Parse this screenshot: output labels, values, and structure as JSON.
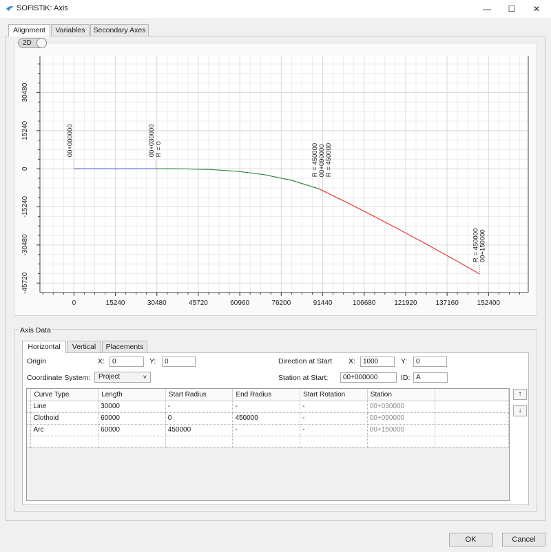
{
  "window": {
    "title": "SOFiSTiK: Axis",
    "minimize": "—",
    "maximize": "☐",
    "close": "✕"
  },
  "tabs": [
    "Alignment",
    "Variables",
    "Secondary Axes"
  ],
  "view_toggle": "2D",
  "chart_data": {
    "type": "line",
    "x_ticks": [
      "0",
      "15240",
      "30480",
      "45720",
      "60960",
      "76200",
      "91440",
      "106680",
      "121920",
      "137160",
      "152400"
    ],
    "y_ticks": [
      "30480",
      "15240",
      "0",
      "-15240",
      "-30480",
      "-45720"
    ],
    "xlim": [
      -12500,
      167000
    ],
    "ylim": [
      -49500,
      45200
    ],
    "grid": true,
    "series": [
      {
        "color": "#4a5de8",
        "x": [
          0,
          30000
        ],
        "y": [
          0,
          0
        ]
      },
      {
        "color": "#2f8a3a",
        "x": [
          30000,
          40000,
          50000,
          60000,
          70000,
          80000,
          89990
        ],
        "y": [
          0,
          -37,
          -296,
          -1000,
          -2370,
          -4630,
          -7995
        ]
      },
      {
        "color": "#e83a3a",
        "x": [
          89990,
          100000,
          110000,
          120000,
          130000,
          140000,
          149150
        ],
        "y": [
          -7995,
          -13333,
          -18867,
          -24566,
          -30427,
          -36449,
          -42100
        ]
      }
    ],
    "annotations": [
      {
        "x": 0,
        "y": 0,
        "lines": [
          "00+000000"
        ]
      },
      {
        "x": 30000,
        "y": 0,
        "lines": [
          "00+030000",
          "R = 0"
        ]
      },
      {
        "x": 89990,
        "y": -7995,
        "lines": [
          "R = 450000",
          "00+090000",
          "R = 450000"
        ]
      },
      {
        "x": 149150,
        "y": -42100,
        "lines": [
          "R = 450000",
          "00+150000"
        ]
      }
    ]
  },
  "axis_data": {
    "label": "Axis Data",
    "tabs": [
      "Horizontal",
      "Vertical",
      "Placements"
    ],
    "origin_label": "Origin",
    "x_label": "X:",
    "y_label": "Y:",
    "origin_x": "0",
    "origin_y": "0",
    "coord_label": "Coordinate System:",
    "coord_value": "Project",
    "coord_chevron": "˅",
    "dir_label": "Direction at Start",
    "dir_x": "1000",
    "dir_y": "0",
    "station_label": "Station at Start:",
    "station_value": "00+000000",
    "id_label": "ID:",
    "id_value": "A",
    "columns": [
      "Curve Type",
      "Length",
      "Start Radius",
      "End Radius",
      "Start Rotation",
      "Station"
    ],
    "rows": [
      [
        "Line",
        "30000",
        "-",
        "-",
        "-",
        "00+030000"
      ],
      [
        "Clothoid",
        "60000",
        "0",
        "450000",
        "-",
        "00+090000"
      ],
      [
        "Arc",
        "60000",
        "450000",
        "-",
        "-",
        "00+150000"
      ],
      [
        "",
        "",
        "",
        "",
        "",
        ""
      ]
    ],
    "up_arrow": "↑",
    "down_arrow": "↓"
  },
  "buttons": {
    "ok": "OK",
    "cancel": "Cancel"
  }
}
